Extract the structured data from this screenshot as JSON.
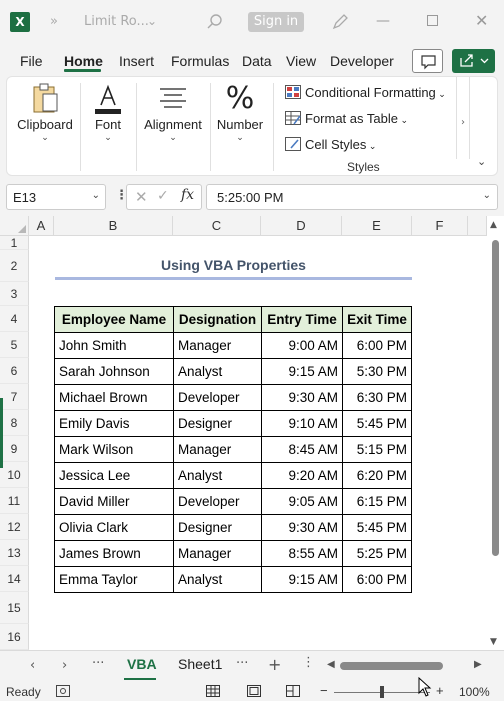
{
  "titlebar": {
    "title": "Limit Ro...",
    "signin_label": "Sign in",
    "app_letter": "X"
  },
  "menu": {
    "tabs": [
      "File",
      "Home",
      "Insert",
      "Formulas",
      "Data",
      "View",
      "Developer"
    ],
    "active": "Home"
  },
  "ribbon": {
    "groups": [
      {
        "label": "Clipboard",
        "icon": "clipboard-icon"
      },
      {
        "label": "Font",
        "icon": "font-color-icon"
      },
      {
        "label": "Alignment",
        "icon": "align-lines-icon"
      },
      {
        "label": "Number",
        "icon": "percent-icon"
      }
    ],
    "styles": {
      "conditional_formatting": "Conditional Formatting",
      "format_as_table": "Format as Table",
      "cell_styles": "Cell Styles",
      "group_label": "Styles"
    }
  },
  "formula_bar": {
    "name_box": "E13",
    "fx_label": "fx",
    "value": "5:25:00 PM"
  },
  "columns": [
    "A",
    "B",
    "C",
    "D",
    "E",
    "F"
  ],
  "rows": [
    "1",
    "2",
    "3",
    "4",
    "5",
    "6",
    "7",
    "8",
    "9",
    "10",
    "11",
    "12",
    "13",
    "14",
    "15",
    "16"
  ],
  "sheet": {
    "title": "Using VBA Properties",
    "headers": [
      "Employee Name",
      "Designation",
      "Entry Time",
      "Exit Time"
    ],
    "data": [
      [
        "John Smith",
        "Manager",
        "9:00 AM",
        "6:00 PM"
      ],
      [
        "Sarah Johnson",
        "Analyst",
        "9:15 AM",
        "5:30 PM"
      ],
      [
        "Michael Brown",
        "Developer",
        "9:30 AM",
        "6:30 PM"
      ],
      [
        "Emily Davis",
        "Designer",
        "9:10 AM",
        "5:45 PM"
      ],
      [
        "Mark Wilson",
        "Manager",
        "8:45 AM",
        "5:15 PM"
      ],
      [
        "Jessica Lee",
        "Analyst",
        "9:20 AM",
        "6:20 PM"
      ],
      [
        "David Miller",
        "Developer",
        "9:05 AM",
        "6:15 PM"
      ],
      [
        "Olivia Clark",
        "Designer",
        "9:30 AM",
        "5:45 PM"
      ],
      [
        "James Brown",
        "Manager",
        "8:55 AM",
        "5:25 PM"
      ],
      [
        "Emma Taylor",
        "Analyst",
        "9:15 AM",
        "6:00 PM"
      ]
    ]
  },
  "sheet_tabs": {
    "tabs": [
      "VBA",
      "Sheet1"
    ],
    "active": "VBA"
  },
  "status": {
    "ready": "Ready",
    "zoom": "100%"
  },
  "colors": {
    "accent": "#1e7145",
    "header_fill": "#e2efda",
    "title_text": "#44546a",
    "title_rule": "#a9b8e0"
  }
}
